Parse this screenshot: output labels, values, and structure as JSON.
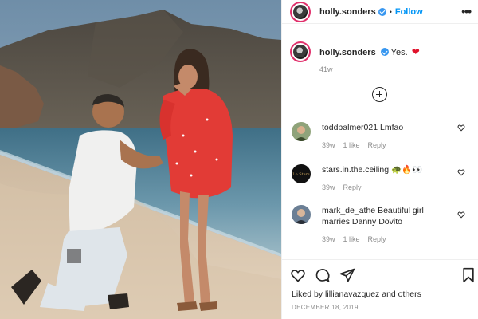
{
  "post": {
    "username": "holly.sonders",
    "follow_label": "Follow",
    "more_label": "•••",
    "separator": "•"
  },
  "caption": {
    "username": "holly.sonders",
    "text": "Yes.",
    "emoji": "❤",
    "time": "41w"
  },
  "comments": [
    {
      "username": "toddpalmer021",
      "text": "Lmfao",
      "time": "39w",
      "likes": "1 like",
      "reply": "Reply"
    },
    {
      "username": "stars.in.the.ceiling",
      "text": "🐢🔥👀",
      "time": "39w",
      "likes": "",
      "reply": "Reply",
      "avatar_text": "Lo Stars"
    },
    {
      "username": "mark_de_athe",
      "text": "Beautiful girl marries Danny Dovito",
      "time": "39w",
      "likes": "1 like",
      "reply": "Reply"
    }
  ],
  "likes": {
    "prefix": "Liked by",
    "user": "lillianavazquez",
    "suffix": "and others"
  },
  "date": "DECEMBER 18, 2019",
  "icons": {
    "header_avatar": "profile-avatar",
    "verified": "verified-badge-icon",
    "add_comments": "plus-circle-icon",
    "like": "heart-icon",
    "comment": "comment-bubble-icon",
    "share": "paper-plane-icon",
    "save": "bookmark-icon"
  },
  "colors": {
    "follow": "#0095f6",
    "verified": "#3897f0",
    "meta_gray": "#8e8e8e",
    "heart_red": "#e0112b"
  }
}
